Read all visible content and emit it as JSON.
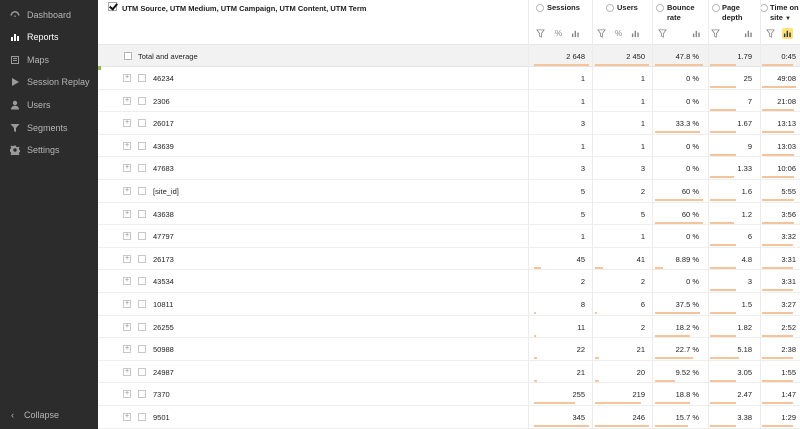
{
  "sidebar": {
    "items": [
      {
        "label": "Dashboard",
        "icon": "dashboard-icon",
        "active": false
      },
      {
        "label": "Reports",
        "icon": "reports-icon",
        "active": true
      },
      {
        "label": "Maps",
        "icon": "maps-icon",
        "active": false
      },
      {
        "label": "Session Replay",
        "icon": "play-icon",
        "active": false
      },
      {
        "label": "Users",
        "icon": "user-icon",
        "active": false
      },
      {
        "label": "Segments",
        "icon": "filter-icon",
        "active": false
      },
      {
        "label": "Settings",
        "icon": "gear-icon",
        "active": false
      }
    ],
    "collapse_label": "Collapse"
  },
  "table": {
    "dimension_title": "UTM Source, UTM Medium, UTM Campaign, UTM Content, UTM Term",
    "columns": [
      {
        "label": "Sessions"
      },
      {
        "label": "Users"
      },
      {
        "label": "Bounce rate"
      },
      {
        "label": "Page depth"
      },
      {
        "label": "Time on site"
      }
    ],
    "col_sort_indicator": "▼",
    "total": {
      "label": "Total and average",
      "values": [
        "2 648",
        "2 450",
        "47.8 %",
        "1.79",
        "0:45"
      ]
    },
    "rows": [
      {
        "label": "46234",
        "values": [
          "1",
          "1",
          "0 %",
          "25",
          "49:08"
        ]
      },
      {
        "label": "2306",
        "values": [
          "1",
          "1",
          "0 %",
          "7",
          "21:08"
        ]
      },
      {
        "label": "26017",
        "values": [
          "3",
          "1",
          "33.3 %",
          "1.67",
          "13:13"
        ]
      },
      {
        "label": "43639",
        "values": [
          "1",
          "1",
          "0 %",
          "9",
          "13:03"
        ]
      },
      {
        "label": "47683",
        "values": [
          "3",
          "3",
          "0 %",
          "1.33",
          "10:06"
        ]
      },
      {
        "label": "[site_id]",
        "values": [
          "5",
          "2",
          "60 %",
          "1.6",
          "5:55"
        ]
      },
      {
        "label": "43638",
        "values": [
          "5",
          "5",
          "60 %",
          "1.2",
          "3:56"
        ]
      },
      {
        "label": "47797",
        "values": [
          "1",
          "1",
          "0 %",
          "6",
          "3:32"
        ]
      },
      {
        "label": "26173",
        "values": [
          "45",
          "41",
          "8.89 %",
          "4.8",
          "3:31"
        ]
      },
      {
        "label": "43534",
        "values": [
          "2",
          "2",
          "0 %",
          "3",
          "3:31"
        ]
      },
      {
        "label": "10811",
        "values": [
          "8",
          "6",
          "37.5 %",
          "1.5",
          "3:27"
        ]
      },
      {
        "label": "26255",
        "values": [
          "11",
          "2",
          "18.2 %",
          "1.82",
          "2:52"
        ]
      },
      {
        "label": "50988",
        "values": [
          "22",
          "21",
          "22.7 %",
          "5.18",
          "2:38"
        ]
      },
      {
        "label": "24987",
        "values": [
          "21",
          "20",
          "9.52 %",
          "3.05",
          "1:55"
        ]
      },
      {
        "label": "7370",
        "values": [
          "255",
          "219",
          "18.8 %",
          "2.47",
          "1:47"
        ]
      },
      {
        "label": "9501",
        "values": [
          "345",
          "246",
          "15.7 %",
          "3.38",
          "1:29"
        ]
      }
    ],
    "bar_fraction": [
      [
        0.0,
        0.0,
        0.0,
        0.55,
        0.95
      ],
      [
        0.0,
        0.0,
        0.0,
        0.55,
        0.9
      ],
      [
        0.0,
        0.0,
        0.9,
        0.55,
        0.9
      ],
      [
        0.0,
        0.0,
        0.0,
        0.55,
        0.9
      ],
      [
        0.0,
        0.0,
        0.0,
        0.5,
        0.9
      ],
      [
        0.0,
        0.0,
        0.95,
        0.55,
        0.9
      ],
      [
        0.0,
        0.0,
        0.95,
        0.5,
        0.9
      ],
      [
        0.0,
        0.0,
        0.0,
        0.55,
        0.85
      ],
      [
        0.12,
        0.15,
        0.15,
        0.55,
        0.85
      ],
      [
        0.0,
        0.0,
        0.0,
        0.55,
        0.85
      ],
      [
        0.02,
        0.02,
        0.9,
        0.55,
        0.85
      ],
      [
        0.03,
        0.0,
        0.7,
        0.55,
        0.85
      ],
      [
        0.06,
        0.08,
        0.75,
        0.6,
        0.85
      ],
      [
        0.06,
        0.08,
        0.4,
        0.55,
        0.85
      ],
      [
        0.75,
        0.85,
        0.7,
        0.55,
        0.85
      ],
      [
        1.0,
        1.0,
        0.65,
        0.55,
        0.85
      ]
    ],
    "total_bar_fraction": [
      1.0,
      1.0,
      0.95,
      0.55,
      0.85
    ],
    "colors": {
      "bar": "#f6c49a",
      "sidebar_bg": "#2c2c2c",
      "active_tool": "#ffe27a",
      "green_marker": "#8bc34a"
    }
  }
}
